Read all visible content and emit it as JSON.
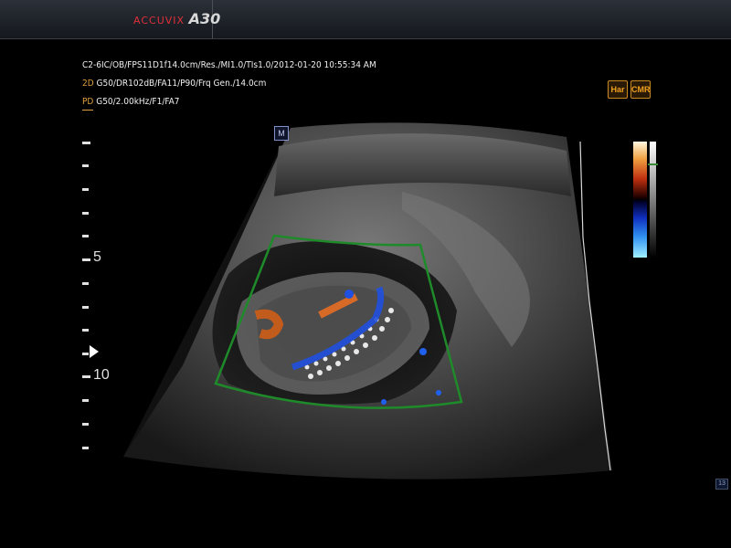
{
  "header": {
    "brand": "ACCUVIX",
    "model": "A30"
  },
  "info_lines": {
    "line1": "C2-6IC/OB/FPS11D1f14.0cm/Res./MI1.0/TIs1.0/2012-01-20 10:55:34 AM",
    "line2_tag": "2D",
    "line2_text": "G50/DR102dB/FA11/P90/Frq Gen./14.0cm",
    "line3_tag": "PD",
    "line3_text": "G50/2.00kHz/F1/FA7"
  },
  "badges": {
    "harmonic": "Har",
    "cmr": "CMR"
  },
  "orientation_marker": "M",
  "depth_scale": {
    "labels": [
      "5",
      "10"
    ]
  },
  "frame_counter": "13",
  "colors": {
    "roi_box": "#1f8a2a",
    "doppler_warm": "#f07020",
    "doppler_cool": "#2060f0",
    "mode_tag": "#e0a040"
  },
  "icons": {
    "focus": "focus-arrow-icon",
    "probe": "probe-orientation-icon"
  }
}
